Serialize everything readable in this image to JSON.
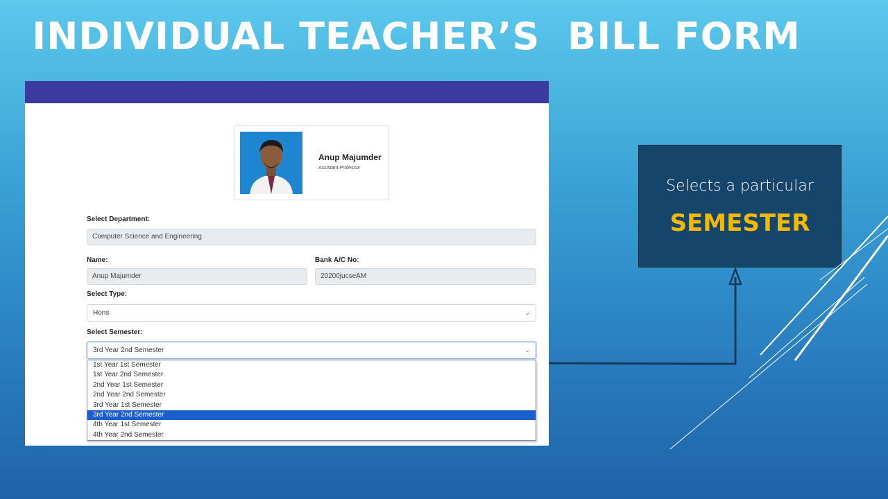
{
  "slide": {
    "title": "INDIVIDUAL TEACHER’S  BILL FORM"
  },
  "profile": {
    "name": "Anup Majumder",
    "designation": "Assistant Professor"
  },
  "form": {
    "department_label": "Select Department:",
    "department_value": "Computer Science and Engineering",
    "name_label": "Name:",
    "name_value": "Anup Majumder",
    "bank_label": "Bank A/C No:",
    "bank_value": "20200jucseAM",
    "type_label": "Select Type:",
    "type_value": "Hons",
    "semester_label": "Select Semester:",
    "semester_value": "3rd Year 2nd Semester",
    "semester_options": [
      "1st Year 1st Semester",
      "1st Year 2nd Semester",
      "2nd Year 1st Semester",
      "2nd Year 2nd Semester",
      "3rd Year 1st Semester",
      "3rd Year 2nd Semester",
      "4th Year 1st Semester",
      "4th Year 2nd Semester"
    ],
    "selected_option_index": 5
  },
  "callout": {
    "line1": "Selects a particular",
    "line2": "SEMESTER"
  },
  "colors": {
    "topbar": "#3b3a9e",
    "callout_bg": "#15456b",
    "callout_accent": "#f5b800",
    "selected_option": "#1b5fcf"
  }
}
